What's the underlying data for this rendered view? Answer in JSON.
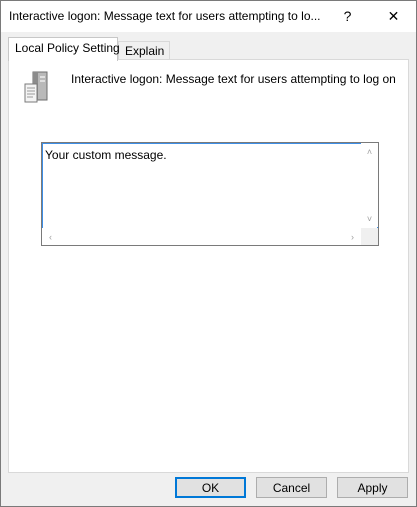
{
  "dialog": {
    "title": "Interactive logon: Message text for users attempting to lo...",
    "help_glyph": "?",
    "close_glyph": "✕"
  },
  "tabs": [
    {
      "label": "Local Policy Setting",
      "active": true
    },
    {
      "label": "Explain",
      "active": false
    }
  ],
  "policy": {
    "icon": "policy-server-icon",
    "title": "Interactive logon: Message text for users attempting to log on"
  },
  "message_box": {
    "value": "Your custom message."
  },
  "buttons": {
    "ok": "OK",
    "cancel": "Cancel",
    "apply": "Apply"
  },
  "colors": {
    "focus_border": "#3d8ee6",
    "default_button_border": "#0078d7"
  }
}
